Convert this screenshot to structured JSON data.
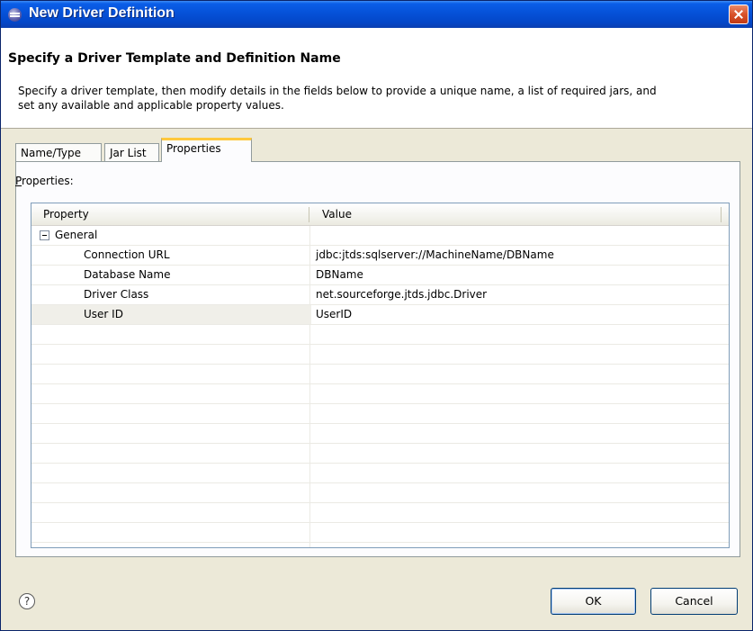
{
  "window": {
    "title": "New Driver Definition",
    "icon": "eclipse-icon",
    "close_icon": "close-icon"
  },
  "header": {
    "title": "Specify a Driver Template and Definition Name",
    "description": "Specify a driver template, then modify details in the fields below to provide a unique name, a list of required jars, and set any available and applicable property values."
  },
  "tabs": [
    {
      "label": "Name/Type",
      "active": false
    },
    {
      "label": "Jar List",
      "active": false
    },
    {
      "label": "Properties",
      "active": true
    }
  ],
  "properties_panel": {
    "label": "Properties:",
    "label_mnemonic": "P",
    "label_rest": "roperties:",
    "columns": [
      "Property",
      "Value"
    ],
    "group": {
      "label": "General",
      "expanded": true
    },
    "rows": [
      {
        "property": "Connection URL",
        "value": "jdbc:jtds:sqlserver://MachineName/DBName"
      },
      {
        "property": "Database Name",
        "value": "DBName"
      },
      {
        "property": "Driver Class",
        "value": "net.sourceforge.jtds.jdbc.Driver"
      },
      {
        "property": "User ID",
        "value": "UserID",
        "selected": true
      }
    ]
  },
  "footer": {
    "help_icon": "help-icon",
    "ok_label": "OK",
    "cancel_label": "Cancel"
  },
  "colors": {
    "titlebar": "#0551d8",
    "dialog_bg": "#ece9d8",
    "active_tab_accent": "#ffc83c",
    "close_button": "#d8522a"
  }
}
